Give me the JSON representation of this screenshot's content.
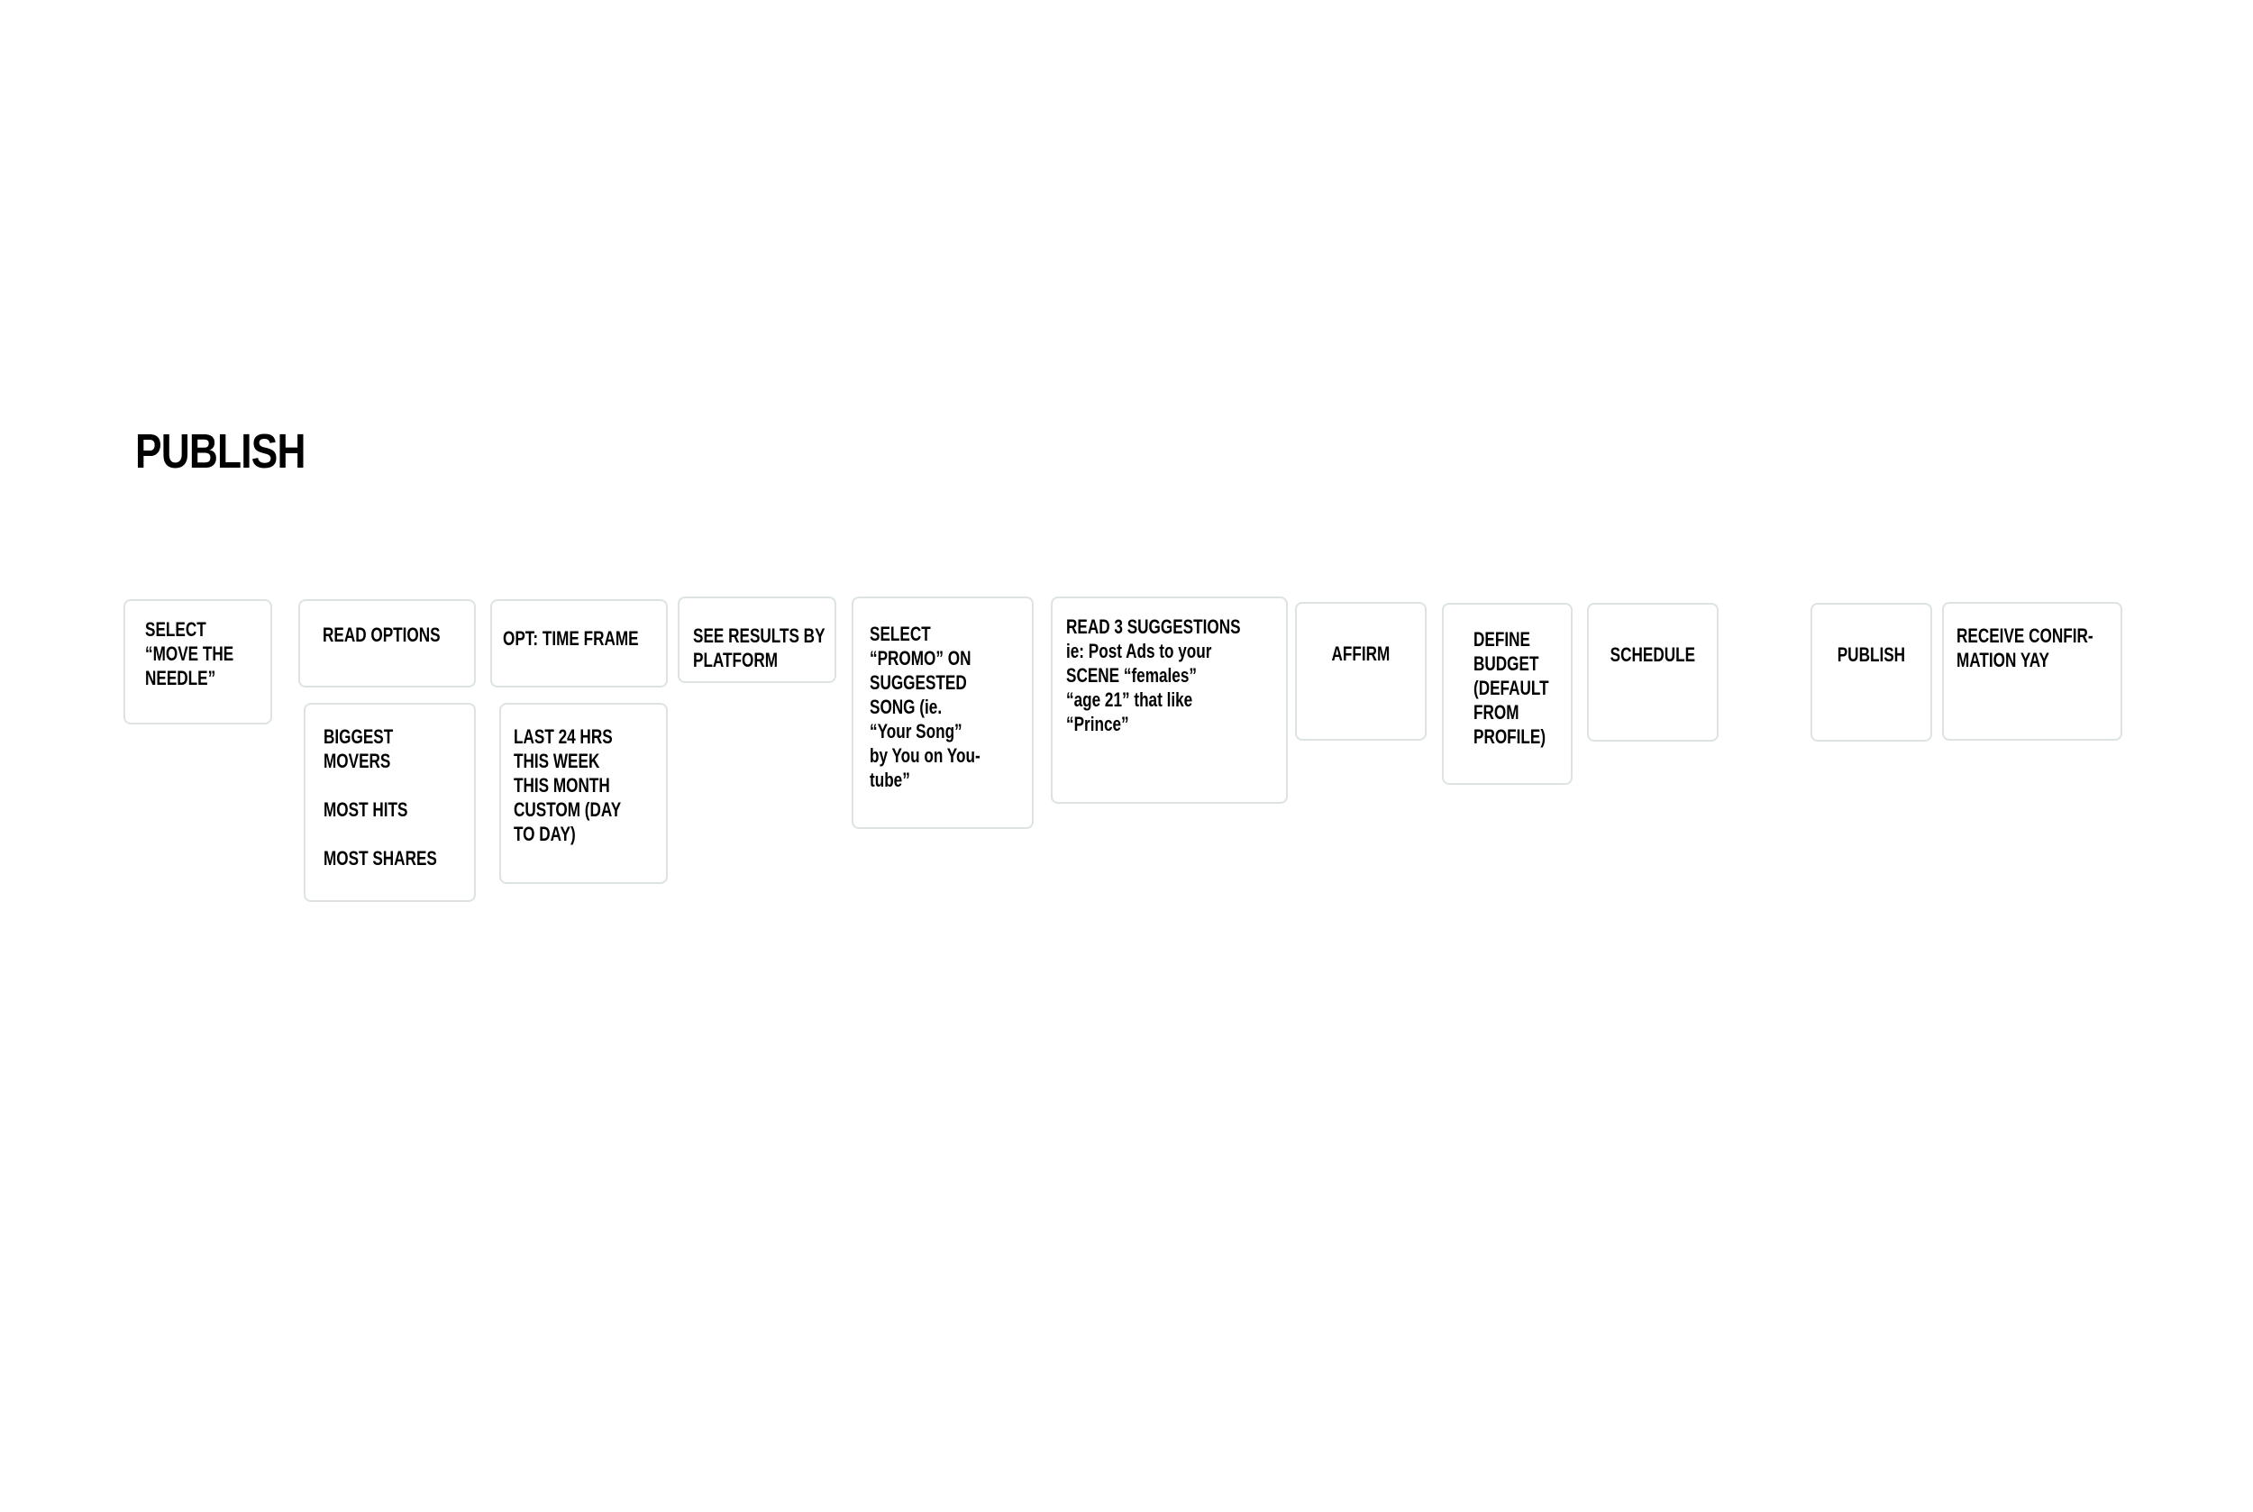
{
  "page": {
    "title": "PUBLISH"
  },
  "flow": {
    "steps": [
      {
        "label": "SELECT\n“MOVE THE\nNEEDLE”"
      },
      {
        "label": "READ OPTIONS"
      },
      {
        "label": "OPT: TIME FRAME"
      },
      {
        "label": "SEE RESULTS BY\nPLATFORM"
      },
      {
        "label": "SELECT\n“PROMO”  ON\nSUGGESTED\nSONG (ie.\n“Your Song”\nby You on You-\ntube”"
      },
      {
        "label": "READ 3 SUGGESTIONS\nie: Post Ads to  your\nSCENE “females”\n“age 21” that like\n“Prince”"
      },
      {
        "label": "AFFIRM"
      },
      {
        "label": "DEFINE\nBUDGET\n(DEFAULT\nFROM\nPROFILE)"
      },
      {
        "label": "SCHEDULE"
      },
      {
        "label": "PUBLISH"
      },
      {
        "label": "RECEIVE CONFIR-\nMATION YAY"
      }
    ],
    "sub_cards": {
      "read_options": {
        "label": "BIGGEST\nMOVERS\n\nMOST HITS\n\nMOST SHARES"
      },
      "time_frame": {
        "label": "LAST 24 HRS\nTHIS WEEK\nTHIS MONTH\nCUSTOM (DAY\nTO DAY)"
      }
    }
  }
}
